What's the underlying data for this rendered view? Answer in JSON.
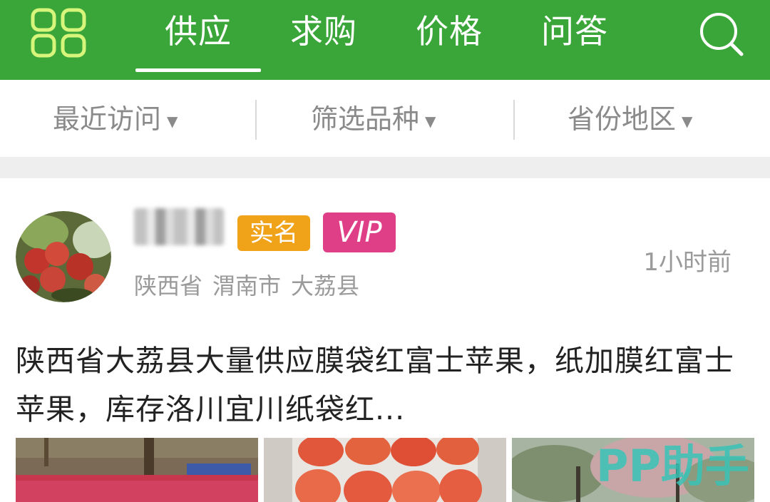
{
  "nav": {
    "tabs": [
      {
        "label": "供应",
        "active": true
      },
      {
        "label": "求购",
        "active": false
      },
      {
        "label": "价格",
        "active": false
      },
      {
        "label": "问答",
        "active": false
      }
    ],
    "menu_icon": "grid-icon",
    "search_icon": "search-icon"
  },
  "filters": [
    {
      "label": "最近访问"
    },
    {
      "label": "筛选品种"
    },
    {
      "label": "省份地区"
    }
  ],
  "post": {
    "badges": {
      "realname": "实名",
      "vip": "VIP"
    },
    "location": {
      "province": "陕西省",
      "city": "渭南市",
      "county": "大荔县"
    },
    "time": "1小时前",
    "description": "陕西省大荔县大量供应膜袋红富士苹果，纸加膜红富士苹果，库存洛川宜川纸袋红..."
  },
  "watermark": "PP助手",
  "colors": {
    "primary_green": "#3aa63a",
    "badge_orange": "#f0a219",
    "badge_pink": "#de3f86"
  }
}
